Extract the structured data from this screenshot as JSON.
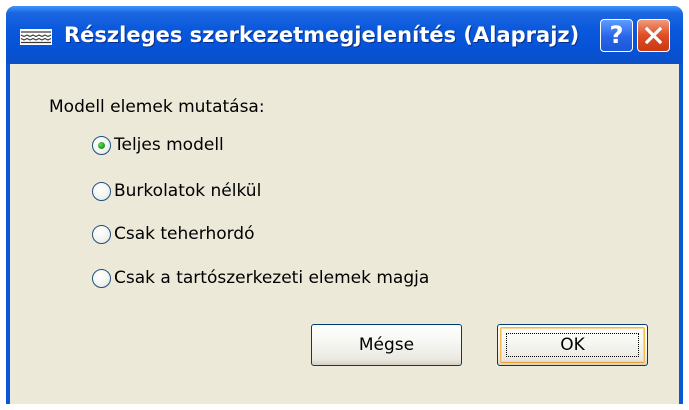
{
  "dialog": {
    "title": "Részleges szerkezetmegjelenítés (Alaprajz)",
    "app_icon": "wall-structure-icon",
    "help_button": {
      "label": "?",
      "icon": "help-icon"
    },
    "close_button": {
      "icon": "close-icon"
    },
    "colors": {
      "titlebar": "#0a58dc",
      "client_background": "#ece9d8",
      "close_button": "#e04d24",
      "selected_radio": "#21a121"
    }
  },
  "options_group": {
    "label": "Modell elemek mutatása:",
    "options": [
      {
        "label": "Teljes modell",
        "selected": true
      },
      {
        "label": "Burkolatok nélkül",
        "selected": false
      },
      {
        "label": "Csak teherhordó",
        "selected": false
      },
      {
        "label": "Csak a tartószerkezeti elemek magja",
        "selected": false
      }
    ]
  },
  "buttons": {
    "cancel": "Mégse",
    "ok": "OK"
  }
}
